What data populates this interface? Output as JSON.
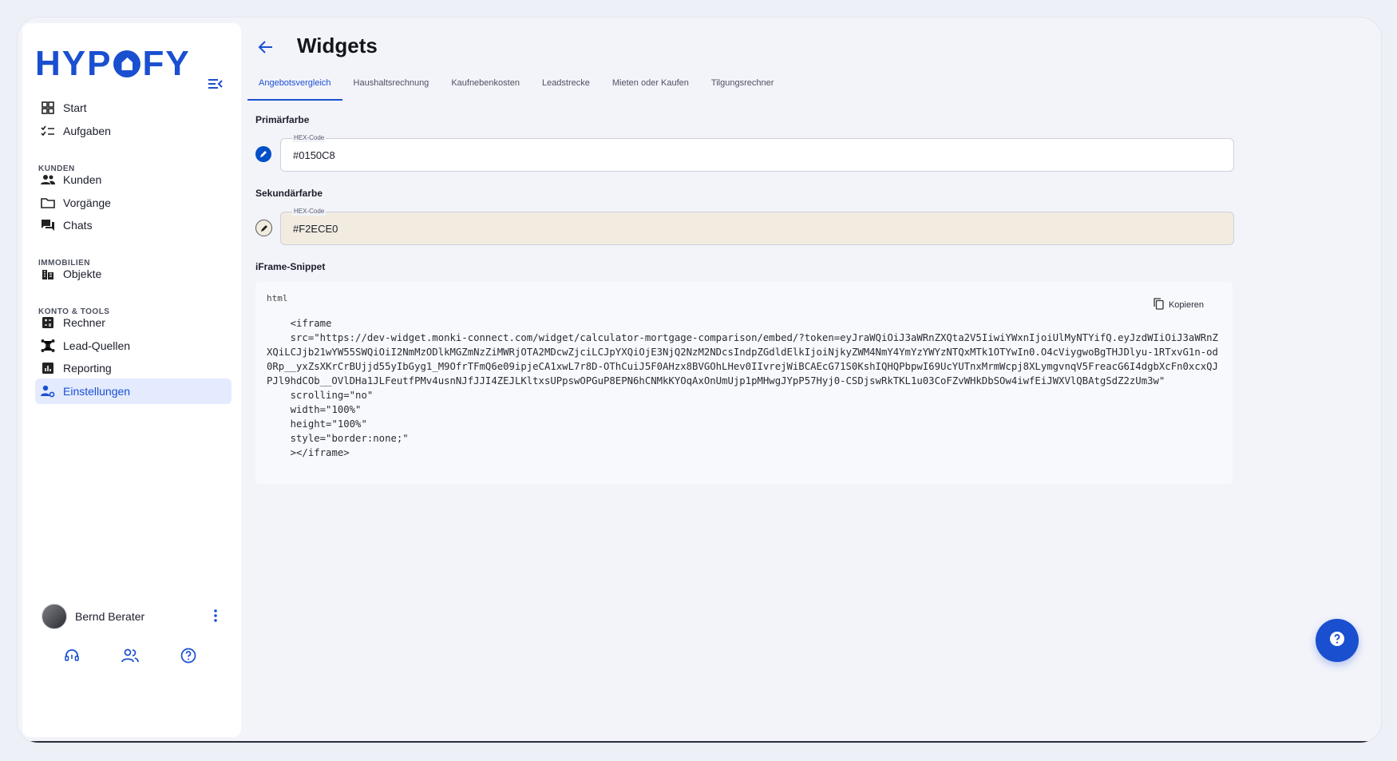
{
  "app": {
    "logo_text": "HYPOFY",
    "accent": "#1a4fd0"
  },
  "sidebar": {
    "items": [
      {
        "label": "Start",
        "icon": "grid-icon"
      },
      {
        "label": "Aufgaben",
        "icon": "checklist-icon"
      },
      {
        "label": "Kunden",
        "icon": "people-icon"
      },
      {
        "label": "Vorgänge",
        "icon": "folder-icon"
      },
      {
        "label": "Chats",
        "icon": "chat-icon"
      },
      {
        "label": "Objekte",
        "icon": "building-icon"
      },
      {
        "label": "Rechner",
        "icon": "calculator-icon"
      },
      {
        "label": "Lead-Quellen",
        "icon": "network-icon"
      },
      {
        "label": "Reporting",
        "icon": "chart-icon"
      },
      {
        "label": "Einstellungen",
        "icon": "user-settings-icon",
        "active": true
      }
    ],
    "sections": {
      "kunden": "KUNDEN",
      "immobilien": "IMMOBILIEN",
      "konto": "KONTO & TOOLS"
    },
    "user": {
      "name": "Bernd Berater"
    }
  },
  "header": {
    "title": "Widgets"
  },
  "tabs": [
    {
      "label": "Angebotsvergleich",
      "active": true
    },
    {
      "label": "Haushaltsrechnung"
    },
    {
      "label": "Kaufnebenkosten"
    },
    {
      "label": "Leadstrecke"
    },
    {
      "label": "Mieten oder Kaufen"
    },
    {
      "label": "Tilgungsrechner"
    }
  ],
  "primary": {
    "label": "Primärfarbe",
    "field_label": "HEX-Code",
    "value": "#0150C8",
    "color": "#0150C8"
  },
  "secondary": {
    "label": "Sekundärfarbe",
    "field_label": "HEX-Code",
    "value": "#F2ECE0",
    "color": "#F2ECE0"
  },
  "snippet": {
    "label": "iFrame-Snippet",
    "language": "html",
    "copy_label": "Kopieren",
    "code": "    <iframe\n    src=\"https://dev-widget.monki-connect.com/widget/calculator-mortgage-comparison/embed/?token=eyJraWQiOiJ3aWRnZXQta2V5IiwiYWxnIjoiUlMyNTYifQ.eyJzdWIiOiJ3aWRnZXQiLCJjb21wYW55SWQiOiI2NmMzODlkMGZmNzZiMWRjOTA2MDcwZjciLCJpYXQiOjE3NjQ2NzM2NDcsIndpZGdldElkIjoiNjkyZWM4NmY4YmYzYWYzNTQxMTk1OTYwIn0.O4cViygwoBgTHJDlyu-1RTxvG1n-od0Rp__yxZsXKrCrBUjjd55yIbGyg1_M9OfrTFmQ6e09ipjeCA1xwL7r8D-OThCuiJ5F0AHzx8BVGOhLHev0IIvrejWiBCAEcG71S0KshIQHQPbpwI69UcYUTnxMrmWcpj8XLymgvnqV5FreacG6I4dgbXcFn0xcxQJPJl9hdCOb__OVlDHa1JLFeutfPMv4usnNJfJJI4ZEJLKltxsUPpswOPGuP8EPN6hCNMkKYOqAxOnUmUjp1pMHwgJYpP57Hyj0-CSDjswRkTKL1u03CoFZvWHkDbSOw4iwfEiJWXVlQBAtgSdZ2zUm3w\"\n    scrolling=\"no\"\n    width=\"100%\"\n    height=\"100%\"\n    style=\"border:none;\"\n    ></iframe>"
  }
}
